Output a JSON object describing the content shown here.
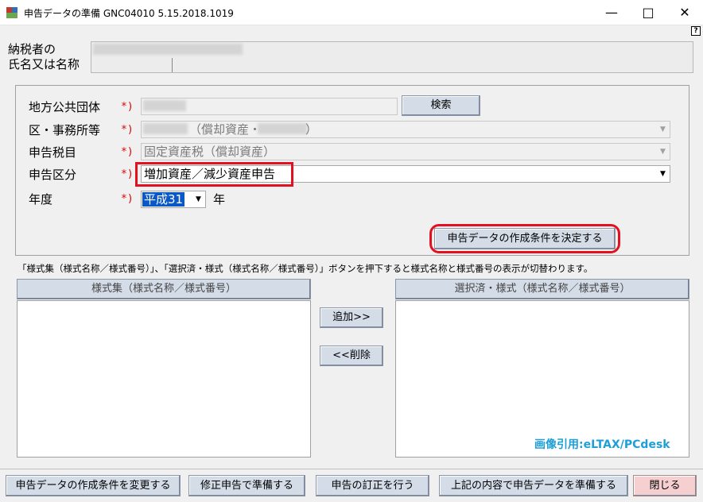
{
  "window": {
    "title": "申告データの準備 GNC04010  5.15.2018.1019",
    "help": "?"
  },
  "taxpayer": {
    "label_line1": "納税者の",
    "label_line2": "氏名又は名称"
  },
  "form": {
    "local_gov_label": "地方公共団体",
    "office_label": "区・事務所等",
    "tax_item_label": "申告税目",
    "category_label": "申告区分",
    "year_label": "年度",
    "required_mark": "*)",
    "search_button": "検索",
    "office_value_suffix": "（償却資産・",
    "office_value_close": "）",
    "tax_item_value": "固定資産税（償却資産）",
    "category_value": "増加資産／減少資産申告",
    "year_value": "平成31",
    "year_unit": "年",
    "decide_button": "申告データの作成条件を決定する"
  },
  "hint": "「様式集（様式名称／様式番号）」、「選択済・様式（様式名称／様式番号）」ボタンを押下すると様式名称と様式番号の表示が切替わります。",
  "lists": {
    "left_header": "様式集（様式名称／様式番号）",
    "right_header": "選択済・様式（様式名称／様式番号）",
    "add_button": "追加>>",
    "remove_button": "<<削除"
  },
  "watermark": "画像引用:eLTAX/PCdesk",
  "footer": {
    "change_button": "申告データの作成条件を変更する",
    "amend_button": "修正申告で準備する",
    "correct_button": "申告の訂正を行う",
    "prepare_button": "上記の内容で申告データを準備する",
    "close_button": "閉じる"
  },
  "colors": {
    "highlight": "#e3101f",
    "required": "#e00000",
    "button_face": "#d4dce8",
    "watermark": "#1e9fd8"
  }
}
